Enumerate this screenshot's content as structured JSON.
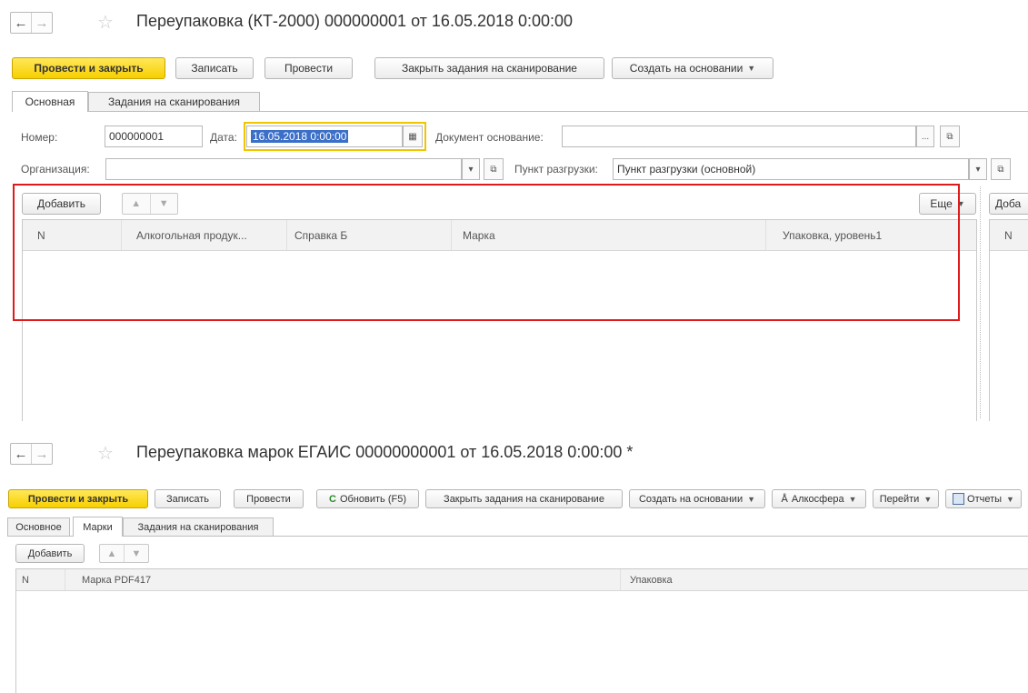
{
  "top": {
    "nav": {
      "back": "←",
      "forward": "→"
    },
    "star": "☆",
    "title": "Переупаковка (КТ-2000) 000000001 от 16.05.2018 0:00:00",
    "toolbar": {
      "post_close": "Провести и закрыть",
      "save": "Записать",
      "post": "Провести",
      "close_tasks": "Закрыть задания на сканирование",
      "create_based": "Создать на основании"
    },
    "tabs": [
      "Основная",
      "Задания на сканирования"
    ],
    "form": {
      "number_label": "Номер:",
      "number_value": "000000001",
      "date_label": "Дата:",
      "date_value": "16.05.2018  0:00:00",
      "base_doc_label": "Документ основание:",
      "base_doc_value": "",
      "org_label": "Организация:",
      "org_value": "",
      "unload_label": "Пункт разгрузки:",
      "unload_value": "Пункт разгрузки (основной)"
    },
    "table": {
      "add": "Добавить",
      "more": "Еще",
      "columns": [
        "N",
        "Алкогольная продук...",
        "Справка Б",
        "Марка",
        "Упаковка, уровень1"
      ]
    },
    "side": {
      "add": "Доба",
      "col": "N"
    },
    "highlight_color": "#e01a1a"
  },
  "bottom": {
    "nav": {
      "back": "←",
      "forward": "→"
    },
    "star": "☆",
    "title": "Переупаковка марок ЕГАИС 00000000001 от 16.05.2018 0:00:00 *",
    "toolbar": {
      "post_close": "Провести и закрыть",
      "save": "Записать",
      "post": "Провести",
      "refresh": "Обновить (F5)",
      "close_tasks": "Закрыть задания на сканирование",
      "create_based": "Создать на основании",
      "alkosfera": "Алкосфера",
      "goto": "Перейти",
      "reports": "Отчеты"
    },
    "tabs": [
      "Основное",
      "Марки",
      "Задания на сканирования"
    ],
    "table": {
      "add": "Добавить",
      "columns": [
        "N",
        "Марка PDF417",
        "Упаковка"
      ]
    }
  },
  "colors": {
    "primary_button": "#f7cf00",
    "date_focus": "#f0c600",
    "selection": "#3b6fc8"
  },
  "icons": [
    "back-arrow-icon",
    "forward-arrow-icon",
    "star-icon",
    "calendar-icon",
    "open-icon",
    "refresh-icon",
    "alkosfera-icon",
    "reports-icon",
    "up-arrow-icon",
    "down-arrow-icon",
    "dropdown-caret-icon"
  ]
}
